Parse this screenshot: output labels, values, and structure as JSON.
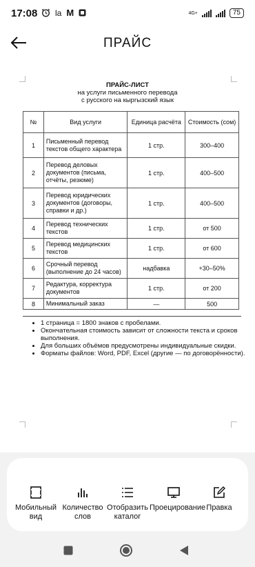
{
  "status_bar": {
    "time": "17:08",
    "left_icons": [
      "alarm-icon",
      "la",
      "M",
      "notification-icon"
    ],
    "network": "4G+",
    "battery": "75"
  },
  "header": {
    "title": "ПРАЙС"
  },
  "document": {
    "title": "ПРАЙС-ЛИСТ",
    "subtitle_1": "на услуги письменного перевода",
    "subtitle_2": "с русского на кыргызский язык",
    "columns": {
      "num": "№",
      "service": "Вид услуги",
      "unit": "Единица расчёта",
      "cost": "Стоимость (сом)"
    },
    "rows": [
      {
        "num": "1",
        "service": "Письменный перевод текстов общего характера",
        "unit": "1 стр.",
        "cost": "300–400"
      },
      {
        "num": "2",
        "service": "Перевод деловых документов (письма, отчёты, резюме)",
        "unit": "1 стр.",
        "cost": "400–500"
      },
      {
        "num": "3",
        "service": "Перевод юридических документов (договоры, справки и др.)",
        "unit": "1 стр.",
        "cost": "400–500"
      },
      {
        "num": "4",
        "service": "Перевод технических текстов",
        "unit": "1 стр.",
        "cost": "от 500"
      },
      {
        "num": "5",
        "service": "Перевод медицинских текстов",
        "unit": "1 стр.",
        "cost": "от 600"
      },
      {
        "num": "6",
        "service": "Срочный перевод (выполнение до 24 часов)",
        "unit": "надбавка",
        "cost": "+30–50%"
      },
      {
        "num": "7",
        "service": "Редактура, корректура документов",
        "unit": "1 стр.",
        "cost": "от 200"
      },
      {
        "num": "8",
        "service": "Минимальный заказ",
        "unit": "—",
        "cost": "500"
      }
    ],
    "notes": [
      "1 страница = 1800 знаков с пробелами.",
      "Окончательная стоимость зависит от сложности текста и сроков выполнения.",
      "Для больших объёмов предусмотрены индивидуальные скидки.",
      "Форматы файлов: Word, PDF, Excel (другие — по договорённости)."
    ]
  },
  "toolbar": {
    "mobile_view": "Мобильный вид",
    "word_count": "Количество слов",
    "show_catalog": "Отобразить каталог",
    "projection": "Проецирование",
    "edit": "Правка"
  }
}
